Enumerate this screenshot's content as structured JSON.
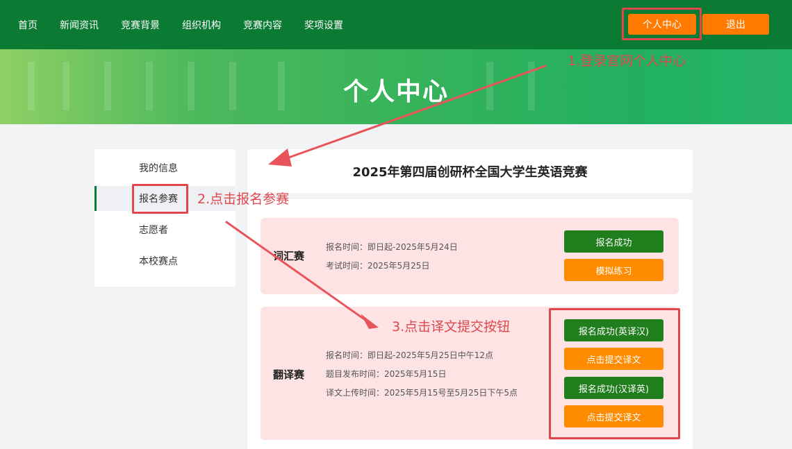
{
  "nav": {
    "items": [
      "首页",
      "新闻资讯",
      "竞赛背景",
      "组织机构",
      "竞赛内容",
      "奖项设置"
    ],
    "personal_center": "个人中心",
    "logout": "退出"
  },
  "banner": {
    "title": "个人中心"
  },
  "sidebar": {
    "items": [
      {
        "label": "我的信息"
      },
      {
        "label": "报名参赛"
      },
      {
        "label": "志愿者"
      },
      {
        "label": "本校赛点"
      }
    ],
    "active_index": 1
  },
  "competition_title": "2025年第四届创研杯全国大学生英语竞赛",
  "vocab": {
    "name": "词汇赛",
    "register_time": "报名时间：即日起-2025年5月24日",
    "exam_time": "考试时间：2025年5月25日",
    "status_btn": "报名成功",
    "practice_btn": "模拟练习"
  },
  "translation": {
    "name": "翻译赛",
    "register_time": "报名时间：即日起-2025年5月25日中午12点",
    "publish_time": "题目发布时间：2025年5月15日",
    "upload_time": "译文上传时间：2025年5月15号至5月25日下午5点",
    "status_en_cn": "报名成功(英译汉)",
    "submit_1": "点击提交译文",
    "status_cn_en": "报名成功(汉译英)",
    "submit_2": "点击提交译文"
  },
  "annotations": {
    "step1": "1.登录官网个人中心",
    "step2": "2.点击报名参赛",
    "step3": "3.点击译文提交按钮",
    "color": "#e0474c"
  },
  "colors": {
    "nav_green": "#0b7a32",
    "accent_orange": "#ff7a00",
    "button_green": "#207e1c",
    "card_pink": "#fde3e3"
  }
}
